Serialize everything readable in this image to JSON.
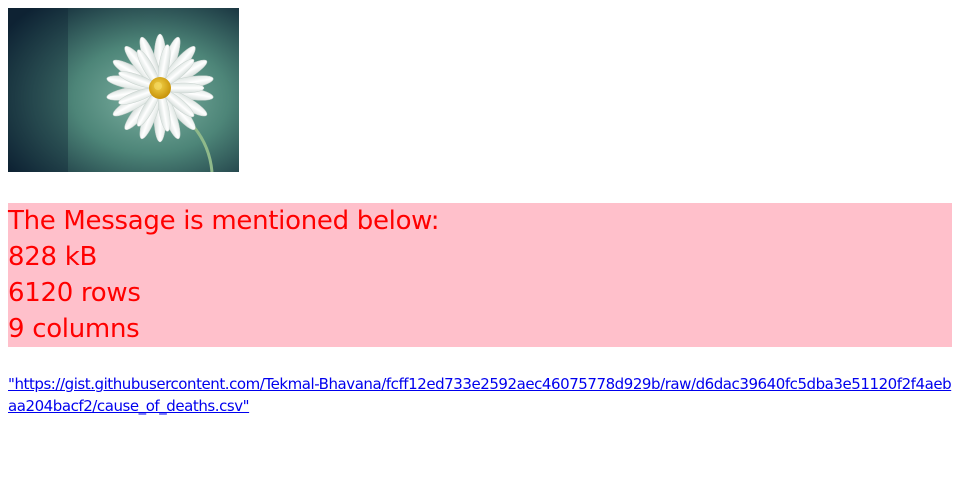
{
  "image": {
    "subject": "white daisy flower on teal background",
    "colors": {
      "background_dark": "#0d2a3a",
      "background_teal": "#5f9a8f",
      "petal": "#f4f6f4",
      "center": "#e2b51c",
      "stem": "#8fb98a"
    }
  },
  "message": {
    "title": "The Message is mentioned below:",
    "size": "828 kB",
    "rows": "6120 rows",
    "columns": "9 columns",
    "background_color": "#ffc0cb",
    "text_color": "#ff0000"
  },
  "link": {
    "text": "\"https://gist.githubusercontent.com/Tekmal-Bhavana/fcff12ed733e2592aec46075778d929b/raw/d6dac39640fc5dba3e51120f2f4aebaa204bacf2/cause_of_deaths.csv\"",
    "color": "#0000ee"
  }
}
